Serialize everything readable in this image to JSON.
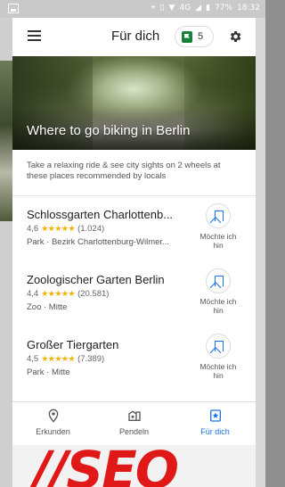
{
  "status_bar": {
    "network": "4G",
    "battery": "77%",
    "time": "18:32"
  },
  "header": {
    "title": "Für dich",
    "saved_count": "5"
  },
  "hero": {
    "title": "Where to go biking in Berlin"
  },
  "intro": {
    "text": "Take a relaxing ride & see city sights on 2 wheels at these places recommended by locals"
  },
  "places": [
    {
      "name": "Schlossgarten Charlottenb...",
      "rating": "4,6",
      "stars": "★★★★★",
      "reviews": "(1.024)",
      "meta": "Park · Bezirk Charlottenburg-Wilmer...",
      "save_label": "Möchte ich hin"
    },
    {
      "name": "Zoologischer Garten Berlin",
      "rating": "4,4",
      "stars": "★★★★★",
      "reviews": "(20.581)",
      "meta": "Zoo · Mitte",
      "save_label": "Möchte ich hin"
    },
    {
      "name": "Großer Tiergarten",
      "rating": "4,5",
      "stars": "★★★★★",
      "reviews": "(7.389)",
      "meta": "Park · Mitte",
      "save_label": "Möchte ich hin"
    }
  ],
  "bottom_nav": {
    "items": [
      {
        "label": "Erkunden",
        "icon": "location-pin-icon"
      },
      {
        "label": "Pendeln",
        "icon": "commute-icon"
      },
      {
        "label": "Für dich",
        "icon": "for-you-icon",
        "active": true
      }
    ]
  },
  "ad": {
    "text": "//SEO"
  },
  "colors": {
    "accent": "#1a73e8",
    "saved_green": "#188038",
    "star": "#f5b000",
    "ad_red": "#e01818"
  }
}
